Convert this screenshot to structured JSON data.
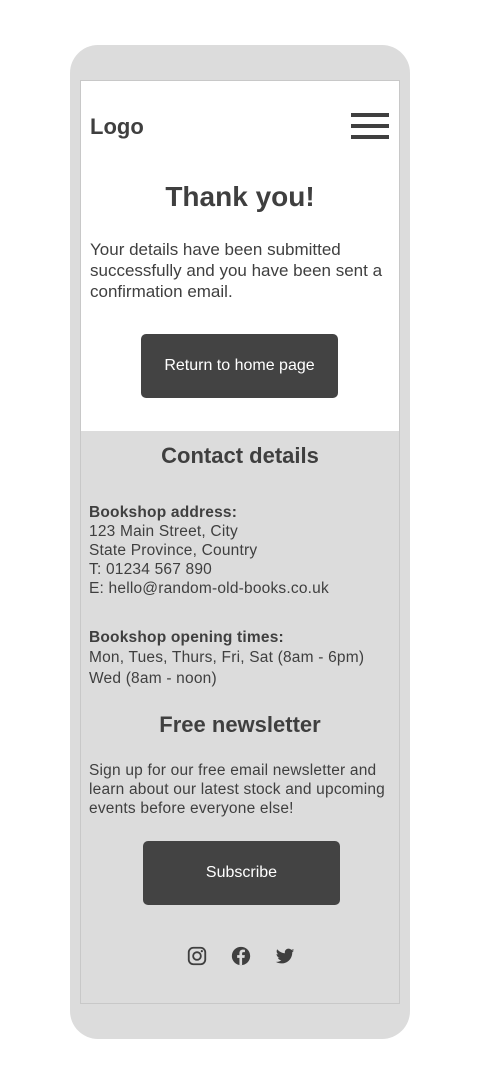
{
  "header": {
    "logo": "Logo",
    "menu_icon": "hamburger-menu-icon"
  },
  "confirmation": {
    "title": "Thank you!",
    "message": "Your details have been submitted successfully and you have been sent a confirmation email.",
    "home_button": "Return to home page"
  },
  "contact": {
    "title": "Contact details",
    "address_label": "Bookshop address:",
    "address_line1": "123 Main Street, City",
    "address_line2": "State Province, Country",
    "phone": "T: 01234 567 890",
    "email": "E: hello@random-old-books.co.uk",
    "hours_label": "Bookshop opening times:",
    "hours_line1": "Mon, Tues, Thurs, Fri, Sat (8am - 6pm)",
    "hours_line2": "Wed (8am - noon)"
  },
  "newsletter": {
    "title": "Free newsletter",
    "text": "Sign up for our free email newsletter and learn about our latest stock and upcoming events before everyone else!",
    "subscribe_button": "Subscribe"
  },
  "socials": {
    "icons": [
      "instagram-icon",
      "facebook-icon",
      "twitter-icon"
    ],
    "icon_color": "#3f3f3f"
  },
  "colors": {
    "text": "#3f3f3f",
    "button": "#434343",
    "footer_bg": "#dcdcdc",
    "page_bg": "#ffffff"
  }
}
